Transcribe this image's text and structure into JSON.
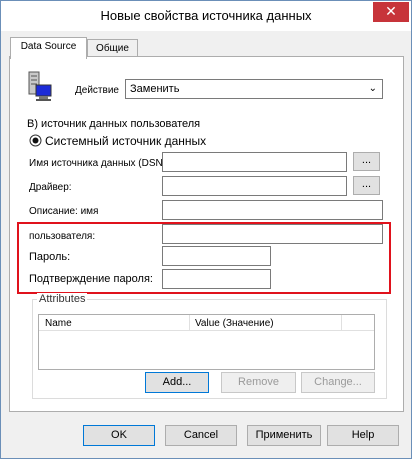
{
  "window": {
    "title": "Новые свойства источника данных",
    "close_glyph": "✕"
  },
  "tabs": [
    {
      "label": "Data Source"
    },
    {
      "label": "Общие"
    }
  ],
  "action": {
    "label": "Действие",
    "value": "Заменить"
  },
  "section": {
    "title": "В) источник данных пользователя",
    "radio_label": "Системный источник данных"
  },
  "fields": {
    "dsn_label": "Имя источника данных (DSN):",
    "driver_label": "Драйвер:",
    "description_label": "Описание: имя",
    "user_label": "пользователя:",
    "password_label": "Пароль:",
    "confirm_label": "Подтверждение пароля:",
    "browse_label": "..."
  },
  "attributes": {
    "legend": "Attributes",
    "columns": [
      "Name",
      "Value (Значение)"
    ],
    "add": "Add...",
    "remove": "Remove",
    "change": "Change..."
  },
  "footer": {
    "ok": "OK",
    "cancel": "Cancel",
    "apply": "Применить",
    "help": "Help"
  },
  "colors": {
    "highlight_box": "#e0121c",
    "close_button": "#c7343a",
    "default_button_border": "#0078d7"
  }
}
